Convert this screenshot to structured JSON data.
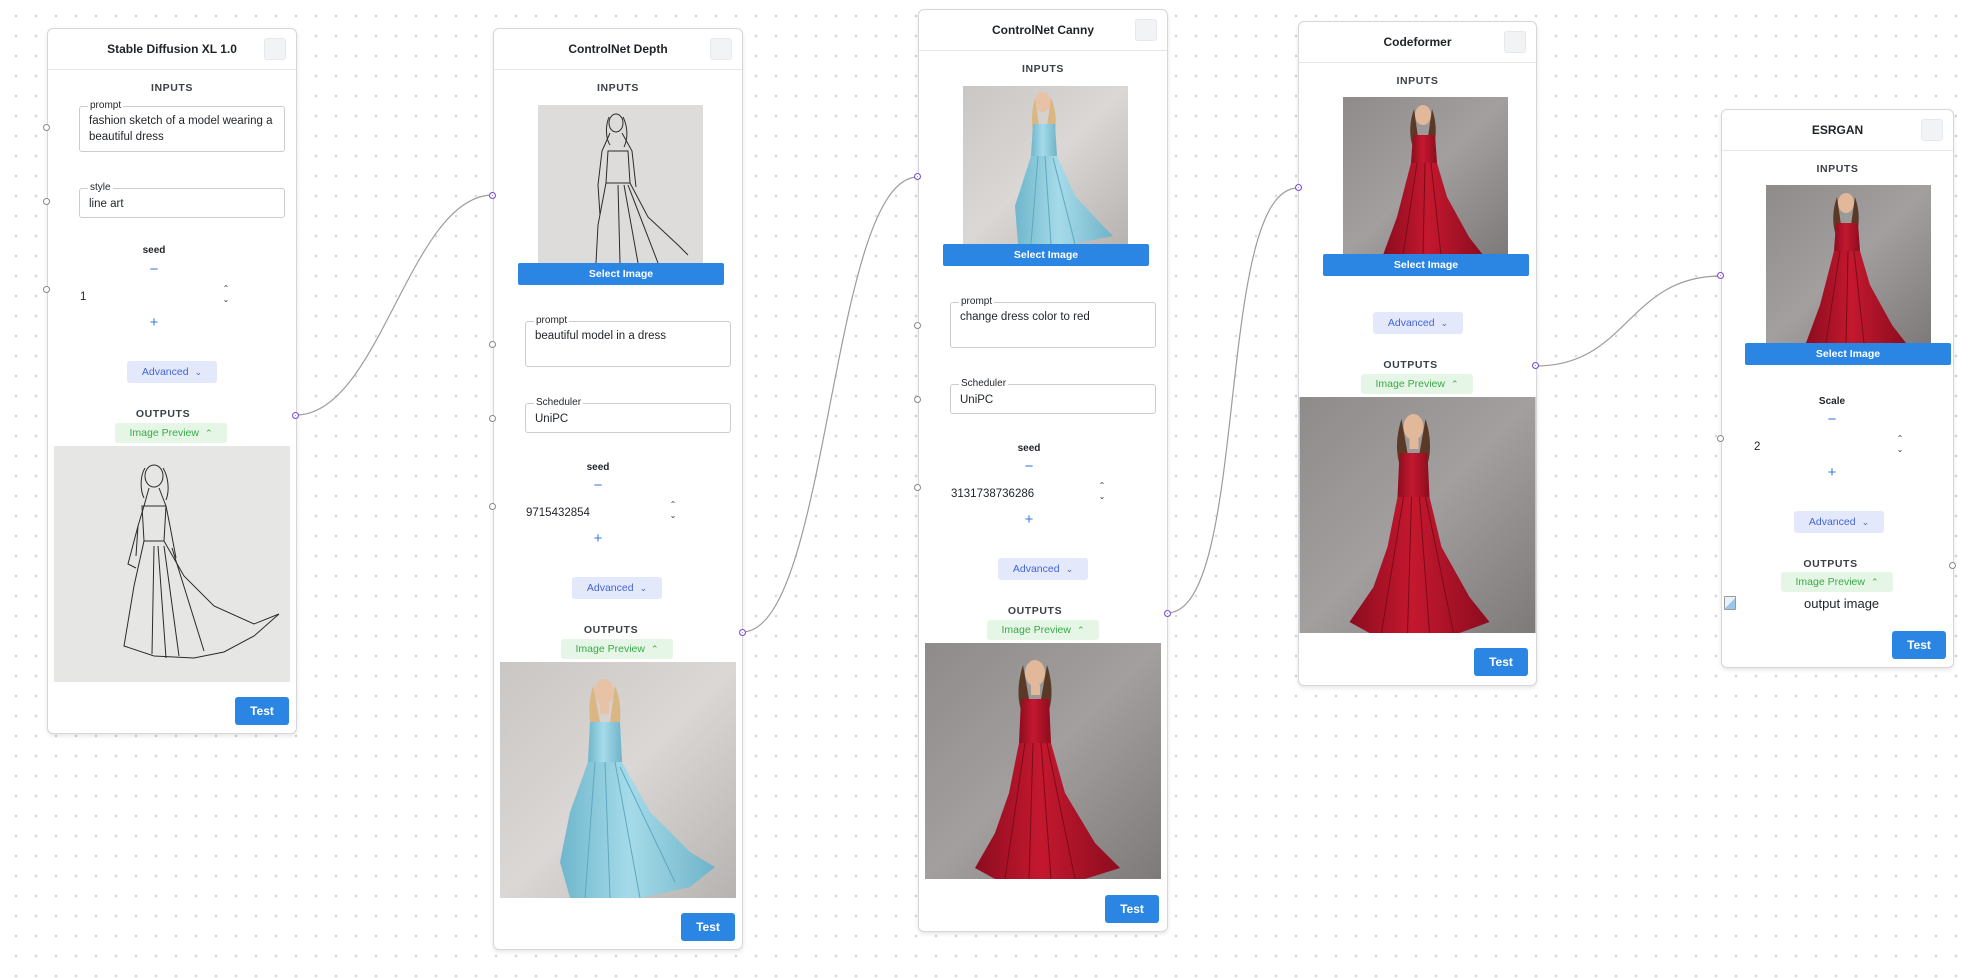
{
  "nodes": {
    "sdxl": {
      "title": "Stable Diffusion XL 1.0",
      "inputs_label": "INPUTS",
      "prompt": {
        "label": "prompt",
        "value": "fashion sketch of a model wearing a beautiful dress"
      },
      "style": {
        "label": "style",
        "value": "line art"
      },
      "seed": {
        "label": "seed",
        "value": "1",
        "minus": "−",
        "plus": "+",
        "up": "⌃",
        "down": "⌄"
      },
      "advanced": "Advanced",
      "outputs_label": "OUTPUTS",
      "preview": "Image Preview",
      "output_image": "sketch-dress-preview",
      "test": "Test"
    },
    "depth": {
      "title": "ControlNet Depth",
      "inputs_label": "INPUTS",
      "input_image": "sketch-dress-input",
      "select_image": "Select Image",
      "prompt": {
        "label": "prompt",
        "value": "beautiful model in a dress"
      },
      "scheduler": {
        "label": "Scheduler",
        "value": "UniPC"
      },
      "seed": {
        "label": "seed",
        "value": "9715432854",
        "minus": "−",
        "plus": "+",
        "up": "⌃",
        "down": "⌄"
      },
      "advanced": "Advanced",
      "outputs_label": "OUTPUTS",
      "preview": "Image Preview",
      "output_image": "blue-dress-photo",
      "test": "Test"
    },
    "canny": {
      "title": "ControlNet Canny",
      "inputs_label": "INPUTS",
      "input_image": "blue-dress-photo",
      "select_image": "Select Image",
      "prompt": {
        "label": "prompt",
        "value": "change dress color to red"
      },
      "scheduler": {
        "label": "Scheduler",
        "value": "UniPC"
      },
      "seed": {
        "label": "seed",
        "value": "3131738736286",
        "minus": "−",
        "plus": "+",
        "up": "⌃",
        "down": "⌄"
      },
      "advanced": "Advanced",
      "outputs_label": "OUTPUTS",
      "preview": "Image Preview",
      "output_image": "red-dress-photo",
      "test": "Test"
    },
    "codeformer": {
      "title": "Codeformer",
      "inputs_label": "INPUTS",
      "input_image": "red-dress-photo",
      "select_image": "Select Image",
      "advanced": "Advanced",
      "outputs_label": "OUTPUTS",
      "preview": "Image Preview",
      "output_image": "red-dress-photo",
      "test": "Test"
    },
    "esrgan": {
      "title": "ESRGAN",
      "inputs_label": "INPUTS",
      "input_image": "red-dress-photo",
      "select_image": "Select Image",
      "scale": {
        "label": "Scale",
        "value": "2",
        "minus": "−",
        "plus": "+",
        "up": "⌃",
        "down": "⌄"
      },
      "advanced": "Advanced",
      "outputs_label": "OUTPUTS",
      "preview": "Image Preview",
      "output_alt": "output image",
      "test": "Test"
    }
  },
  "icons": {
    "advanced_chevron": "chevron-down-icon",
    "preview_chevron": "chevron-up-icon",
    "menu": "node-menu-icon"
  },
  "colors": {
    "primary_button": "#2b86e3",
    "advanced_bg": "#e3e8fb",
    "advanced_text": "#4466d6",
    "preview_bg": "#e5f6e6",
    "preview_text": "#3aaa48",
    "edge": "#9a9ca0",
    "handle_active": "#8b5cf6",
    "red_dress": "#b3122a",
    "blue_dress": "#8fcde0"
  }
}
